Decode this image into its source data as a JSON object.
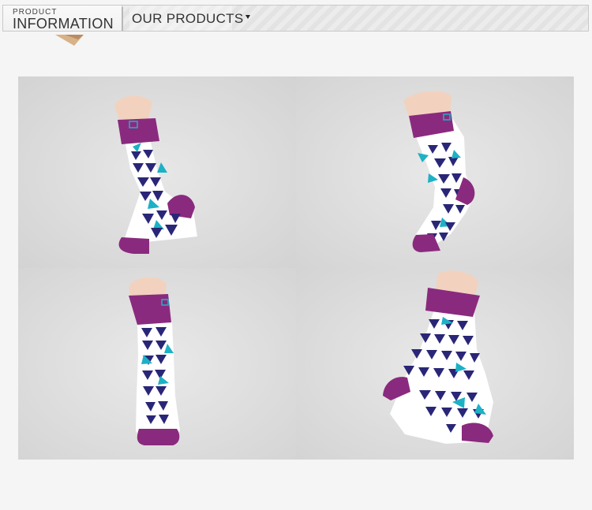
{
  "header": {
    "section_small": "PRODUCT",
    "section_big": "INFORMATION",
    "tab_label": "OUR PRODUCTS"
  },
  "gallery": {
    "images": [
      {
        "name": "sock-photo-1",
        "pose": "angled-left"
      },
      {
        "name": "sock-photo-2",
        "pose": "angled-right"
      },
      {
        "name": "sock-photo-3",
        "pose": "front"
      },
      {
        "name": "sock-photo-4",
        "pose": "side"
      }
    ]
  },
  "colors": {
    "purple": "#8a2a7e",
    "navy": "#2a2677",
    "teal": "#1db1c6",
    "white": "#ffffff",
    "skin": "#f2d2bf",
    "backdrop": "#d9d9d9"
  },
  "icons": {
    "dropdown": "triangle-down-icon"
  }
}
